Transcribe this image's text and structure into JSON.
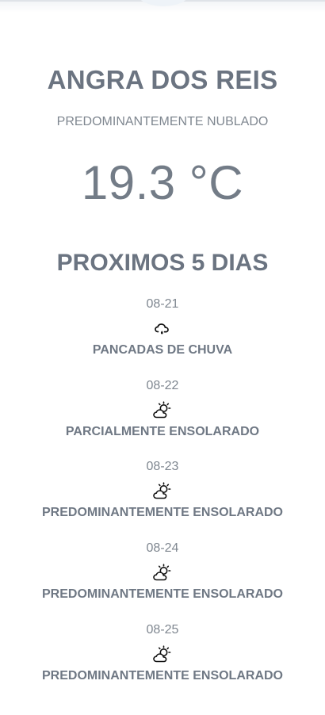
{
  "city": "ANGRA DOS REIS",
  "condition": "PREDOMINANTEMENTE NUBLADO",
  "temperature": "19.3 °C",
  "forecast_title": "PROXIMOS 5 DIAS",
  "forecast": [
    {
      "date": "08-21",
      "icon": "rain-cloud-icon",
      "label": "PANCADAS DE CHUVA"
    },
    {
      "date": "08-22",
      "icon": "sun-cloud-icon",
      "label": "PARCIALMENTE ENSOLARADO"
    },
    {
      "date": "08-23",
      "icon": "sun-cloud-icon",
      "label": "PREDOMINANTEMENTE ENSOLARADO"
    },
    {
      "date": "08-24",
      "icon": "sun-cloud-icon",
      "label": "PREDOMINANTEMENTE ENSOLARADO"
    },
    {
      "date": "08-25",
      "icon": "sun-cloud-icon",
      "label": "PREDOMINANTEMENTE ENSOLARADO"
    }
  ],
  "colors": {
    "text": "#6b7481",
    "muted": "#7f8790",
    "background": "#ffffff"
  }
}
